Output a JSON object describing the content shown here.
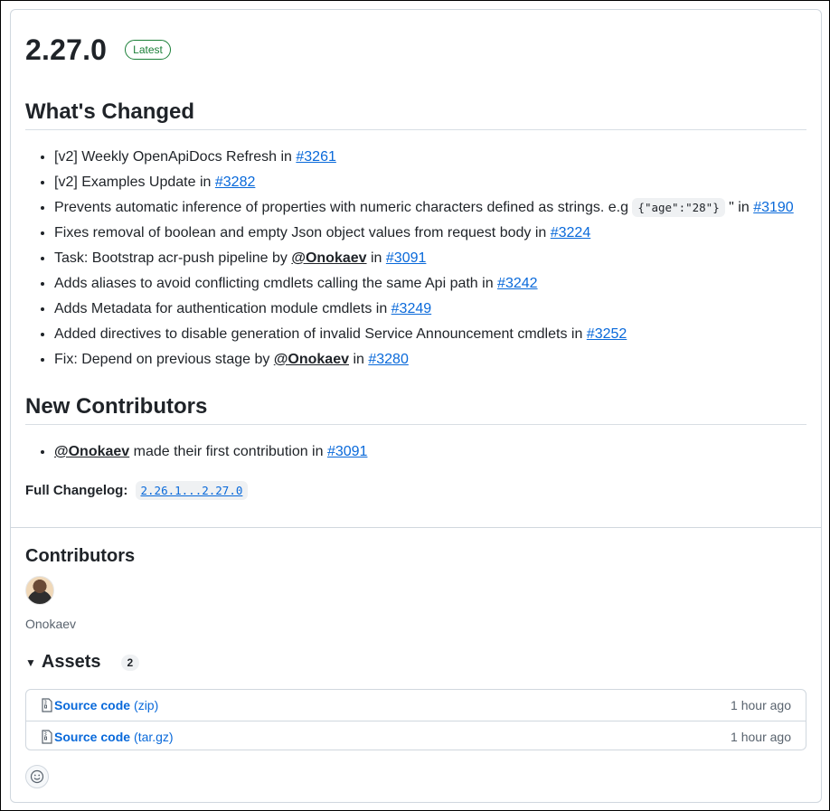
{
  "release": {
    "version": "2.27.0",
    "badge": "Latest"
  },
  "whats_changed": {
    "title": "What's Changed",
    "items": [
      {
        "text": "[v2] Weekly OpenApiDocs Refresh in ",
        "pr": "#3261"
      },
      {
        "text": "[v2] Examples Update in ",
        "pr": "#3282"
      },
      {
        "text": "Prevents automatic inference of properties with numeric characters defined as strings. e.g ",
        "code": "{\"age\":\"28\"}",
        "after": " \" in ",
        "pr": "#3190"
      },
      {
        "text": "Fixes removal of boolean and empty Json object values from request body in ",
        "pr": "#3224"
      },
      {
        "text": "Task: Bootstrap acr-push pipeline by ",
        "mention": "@Onokaev",
        "after": " in ",
        "pr": "#3091"
      },
      {
        "text": "Adds aliases to avoid conflicting cmdlets calling the same Api path in ",
        "pr": "#3242"
      },
      {
        "text": "Adds Metadata for authentication module cmdlets in ",
        "pr": "#3249"
      },
      {
        "text": "Added directives to disable generation of invalid Service Announcement cmdlets in ",
        "pr": "#3252"
      },
      {
        "text": "Fix: Depend on previous stage by ",
        "mention": "@Onokaev",
        "after": " in ",
        "pr": "#3280"
      }
    ]
  },
  "new_contributors": {
    "title": "New Contributors",
    "items": [
      {
        "mention": "@Onokaev",
        "text": " made their first contribution in ",
        "pr": "#3091"
      }
    ]
  },
  "full_changelog": {
    "label": "Full Changelog",
    "colon": ":",
    "value": "2.26.1...2.27.0"
  },
  "contributors": {
    "title": "Contributors",
    "names": [
      "Onokaev"
    ]
  },
  "assets": {
    "title": "Assets",
    "count": "2",
    "rows": [
      {
        "name": "Source code",
        "ext": "(zip)",
        "time": "1 hour ago"
      },
      {
        "name": "Source code",
        "ext": "(tar.gz)",
        "time": "1 hour ago"
      }
    ]
  },
  "colors": {
    "link": "#0969da",
    "latest_badge": "#1a7f37",
    "muted": "#59636e",
    "border": "#d0d7de"
  },
  "icons": {
    "zip": "file-zip-icon",
    "caret": "triangle-down-icon",
    "reaction": "smiley-icon"
  }
}
